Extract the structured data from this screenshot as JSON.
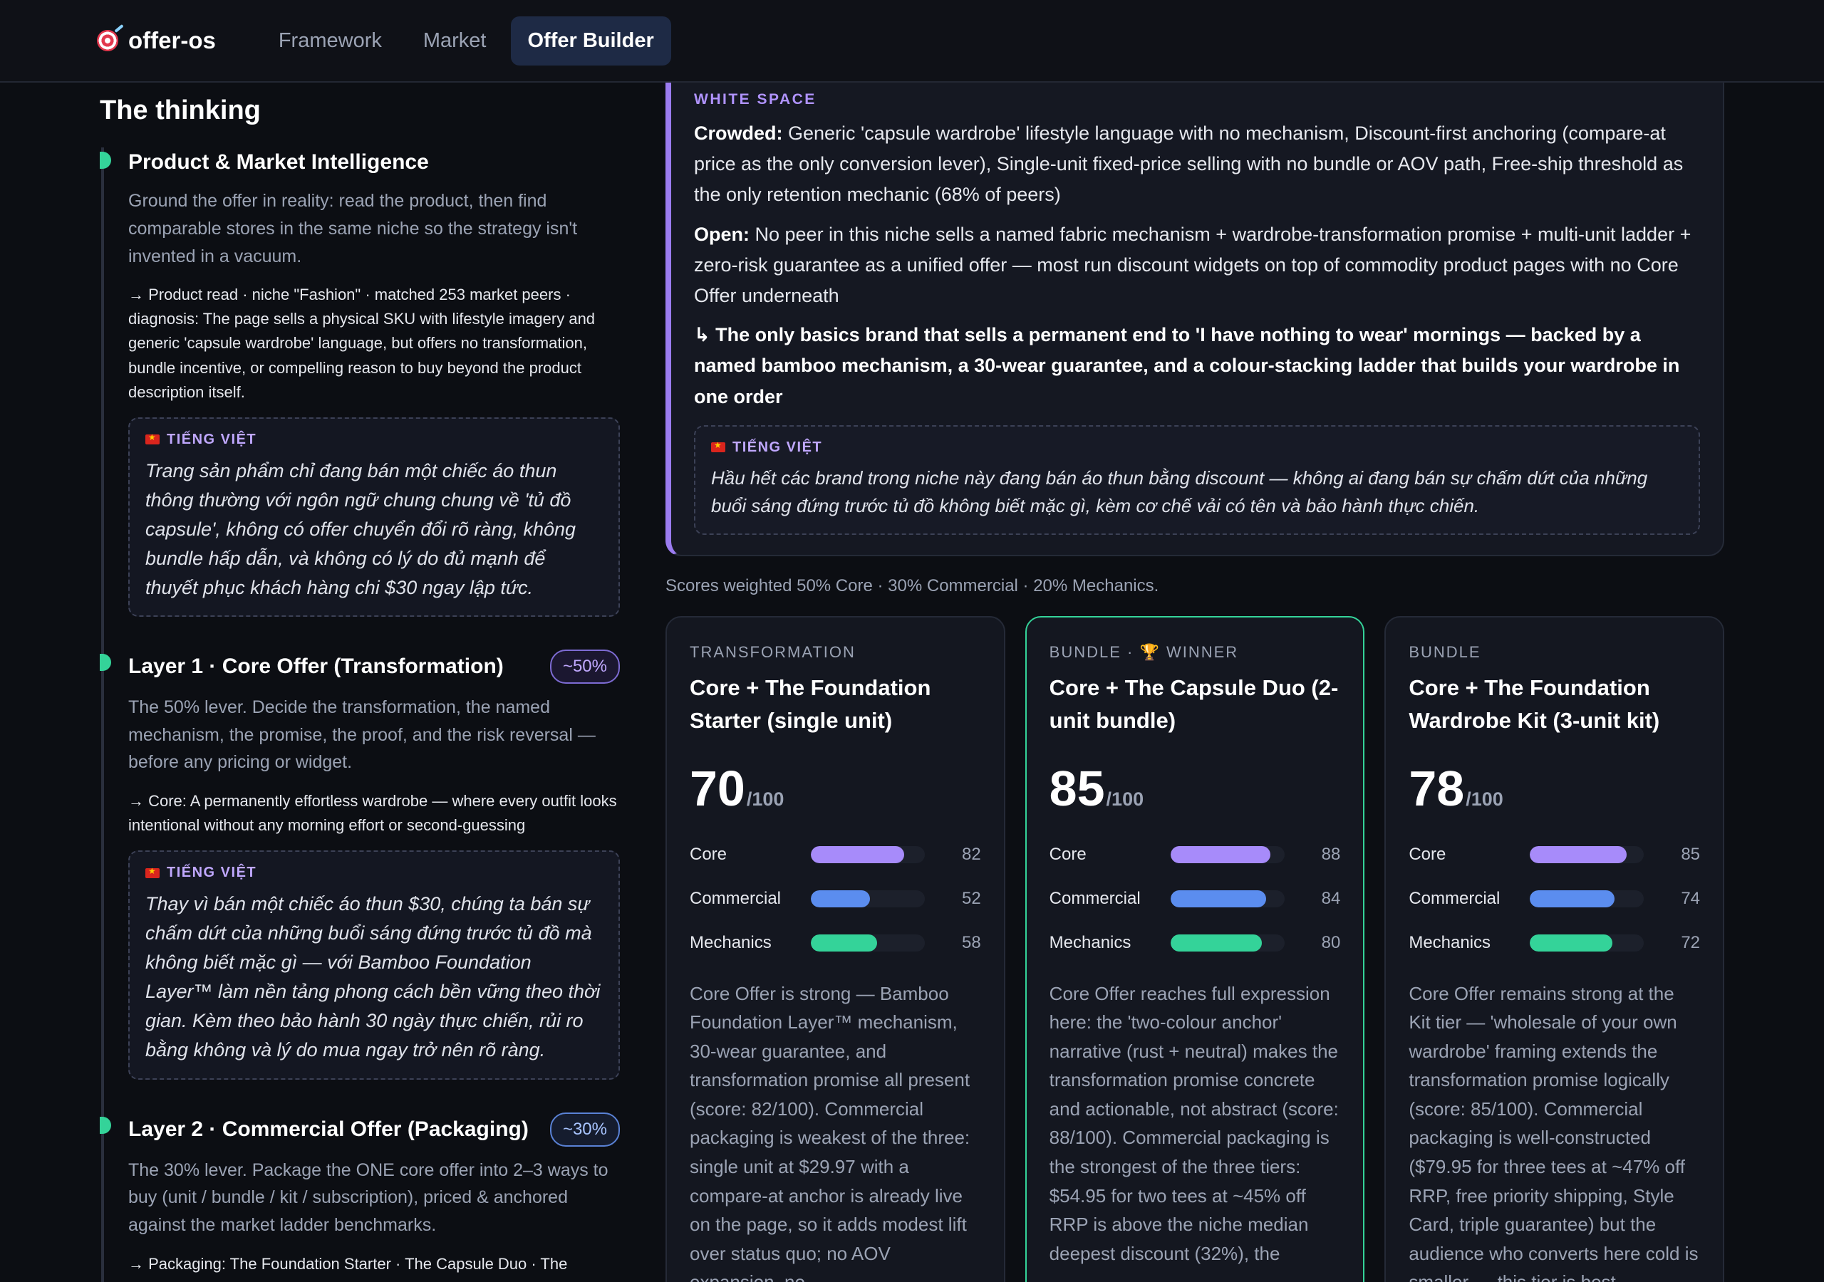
{
  "app": {
    "name": "offer-os"
  },
  "nav": [
    {
      "label": "Framework",
      "active": false
    },
    {
      "label": "Market",
      "active": false
    },
    {
      "label": "Offer Builder",
      "active": true
    }
  ],
  "thinking": {
    "title": "The thinking",
    "vi_label": "TIẾNG VIỆT",
    "steps": [
      {
        "title": "Product & Market Intelligence",
        "pill": "",
        "desc": "Ground the offer in reality: read the product, then find comparable stores in the same niche so the strategy isn't invented in a vacuum.",
        "result": "→ Product read · niche \"Fashion\" · matched 253 market peers · diagnosis: The page sells a physical SKU with lifestyle imagery and generic 'capsule wardrobe' language, but offers no transformation, bundle incentive, or compelling reason to buy beyond the product description itself.",
        "vi": "Trang sản phẩm chỉ đang bán một chiếc áo thun thông thường với ngôn ngữ chung chung về 'tủ đồ capsule', không có offer chuyển đổi rõ ràng, không bundle hấp dẫn, và không có lý do đủ mạnh để thuyết phục khách hàng chi $30 ngay lập tức."
      },
      {
        "title": "Layer 1 · Core Offer (Transformation)",
        "pill": "~50%",
        "desc": "The 50% lever. Decide the transformation, the named mechanism, the promise, the proof, and the risk reversal — before any pricing or widget.",
        "result": "→ Core: A permanently effortless wardrobe — where every outfit looks intentional without any morning effort or second-guessing",
        "vi": "Thay vì bán một chiếc áo thun $30, chúng ta bán sự chấm dứt của những buổi sáng đứng trước tủ đồ mà không biết mặc gì — với Bamboo Foundation Layer™ làm nền tảng phong cách bền vững theo thời gian. Kèm theo bảo hành 30 ngày thực chiến, rủi ro bằng không và lý do mua ngay trở nên rõ ràng."
      },
      {
        "title": "Layer 2 · Commercial Offer (Packaging)",
        "pill": "~30%",
        "desc": "The 30% lever. Package the ONE core offer into 2–3 ways to buy (unit / bundle / kit / subscription), priced & anchored against the market ladder benchmarks.",
        "result": "→ Packaging: The Foundation Starter · The Capsule Duo · The"
      }
    ]
  },
  "white_space": {
    "label": "WHITE SPACE",
    "crowded_label": "Crowded:",
    "crowded": " Generic 'capsule wardrobe' lifestyle language with no mechanism, Discount-first anchoring (compare-at price as the only conversion lever), Single-unit fixed-price selling with no bundle or AOV path, Free-ship threshold as the only retention mechanic (68% of peers)",
    "open_label": "Open:",
    "open": " No peer in this niche sells a named fabric mechanism + wardrobe-transformation promise + multi-unit ladder + zero-risk guarantee as a unified offer — most run discount widgets on top of commodity product pages with no Core Offer underneath",
    "positioning": "↳ The only basics brand that sells a permanent end to 'I have nothing to wear' mornings — backed by a named bamboo mechanism, a 30-wear guarantee, and a colour-stacking ladder that builds your wardrobe in one order",
    "vi_label": "TIẾNG VIỆT",
    "vi": "Hầu hết các brand trong niche này đang bán áo thun bằng discount — không ai đang bán sự chấm dứt của những buổi sáng đứng trước tủ đồ không biết mặc gì, kèm cơ chế vải có tên và bảo hành thực chiến."
  },
  "weights_note": "Scores weighted 50% Core · 30% Commercial · 20% Mechanics.",
  "score_denominator": "/100",
  "bar_labels": {
    "core": "Core",
    "commercial": "Commercial",
    "mechanics": "Mechanics"
  },
  "options": [
    {
      "kicker": "TRANSFORMATION",
      "winner": false,
      "title": "Core + The Foundation Starter (single unit)",
      "score": "70",
      "core": 82,
      "commercial": 52,
      "mechanics": 58,
      "desc": "Core Offer is strong — Bamboo Foundation Layer™ mechanism, 30-wear guarantee, and transformation promise all present (score: 82/100). Commercial packaging is weakest of the three: single unit at $29.97 with a compare-at anchor is already live on the page, so it adds modest lift over status quo; no AOV expansion, no"
    },
    {
      "kicker": "BUNDLE · 🏆 WINNER",
      "winner": true,
      "title": "Core + The Capsule Duo (2-unit bundle)",
      "score": "85",
      "core": 88,
      "commercial": 84,
      "mechanics": 80,
      "desc": "Core Offer reaches full expression here: the 'two-colour anchor' narrative (rust + neutral) makes the transformation promise concrete and actionable, not abstract (score: 88/100). Commercial packaging is the strongest of the three tiers: $54.95 for two tees at ~45% off RRP is above the niche median deepest discount (32%), the"
    },
    {
      "kicker": "BUNDLE",
      "winner": false,
      "title": "Core + The Foundation Wardrobe Kit (3-unit kit)",
      "score": "78",
      "core": 85,
      "commercial": 74,
      "mechanics": 72,
      "desc": "Core Offer remains strong at the Kit tier — 'wholesale of your own wardrobe' framing extends the transformation promise logically (score: 85/100). Commercial packaging is well-constructed ($79.95 for three tees at ~47% off RRP, free priority shipping, Style Card, triple guarantee) but the audience who converts here cold is smaller — this tier is best"
    }
  ]
}
